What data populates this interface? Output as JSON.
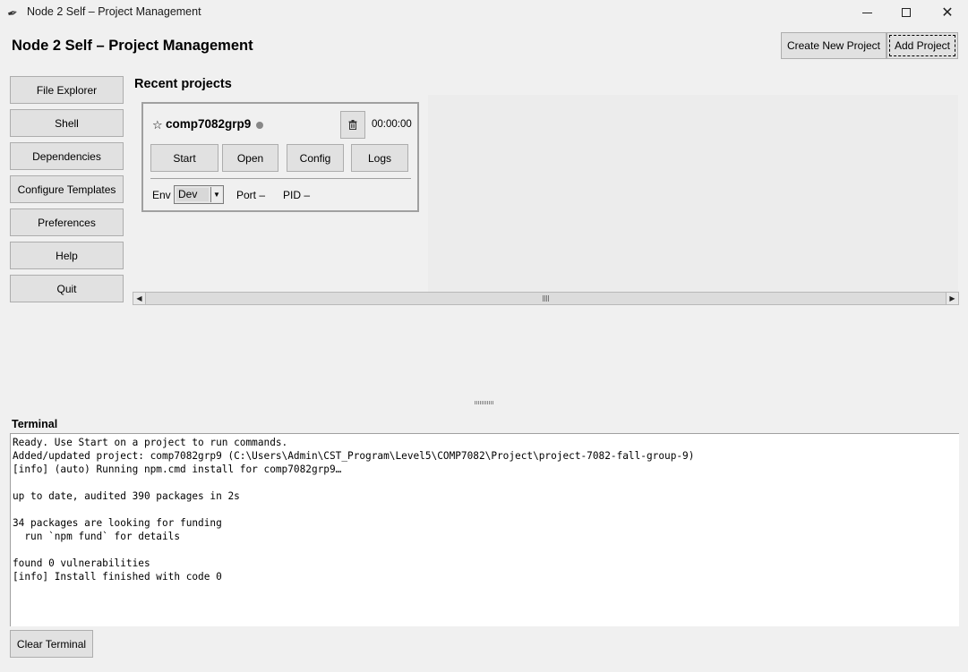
{
  "window": {
    "title": "Node 2 Self – Project Management"
  },
  "header": {
    "title": "Node 2 Self – Project Management",
    "create_label": "Create New Project",
    "add_label": "Add Project"
  },
  "sidebar": {
    "items": [
      {
        "label": "File Explorer"
      },
      {
        "label": "Shell"
      },
      {
        "label": "Dependencies"
      },
      {
        "label": "Configure Templates"
      },
      {
        "label": "Preferences"
      },
      {
        "label": "Help"
      },
      {
        "label": "Quit"
      }
    ]
  },
  "recent": {
    "heading": "Recent projects",
    "card": {
      "star": "☆",
      "name": "comp7082grp9",
      "uptime": "00:00:00",
      "buttons": {
        "start": "Start",
        "open": "Open",
        "config": "Config",
        "logs": "Logs"
      },
      "env_label": "Env",
      "env_value": "Dev",
      "port_label": "Port –",
      "pid_label": "PID –"
    }
  },
  "terminal": {
    "label": "Terminal",
    "text": "Ready. Use Start on a project to run commands.\nAdded/updated project: comp7082grp9 (C:\\Users\\Admin\\CST_Program\\Level5\\COMP7082\\Project\\project-7082-fall-group-9)\n[info] (auto) Running npm.cmd install for comp7082grp9…\n\nup to date, audited 390 packages in 2s\n\n34 packages are looking for funding\n  run `npm fund` for details\n\nfound 0 vulnerabilities\n[info] Install finished with code 0",
    "clear_label": "Clear Terminal"
  },
  "colors": {
    "window_bg": "#f0f0f0",
    "button_bg": "#e1e1e1",
    "button_border": "#adadad",
    "status_dot": "#888888"
  }
}
